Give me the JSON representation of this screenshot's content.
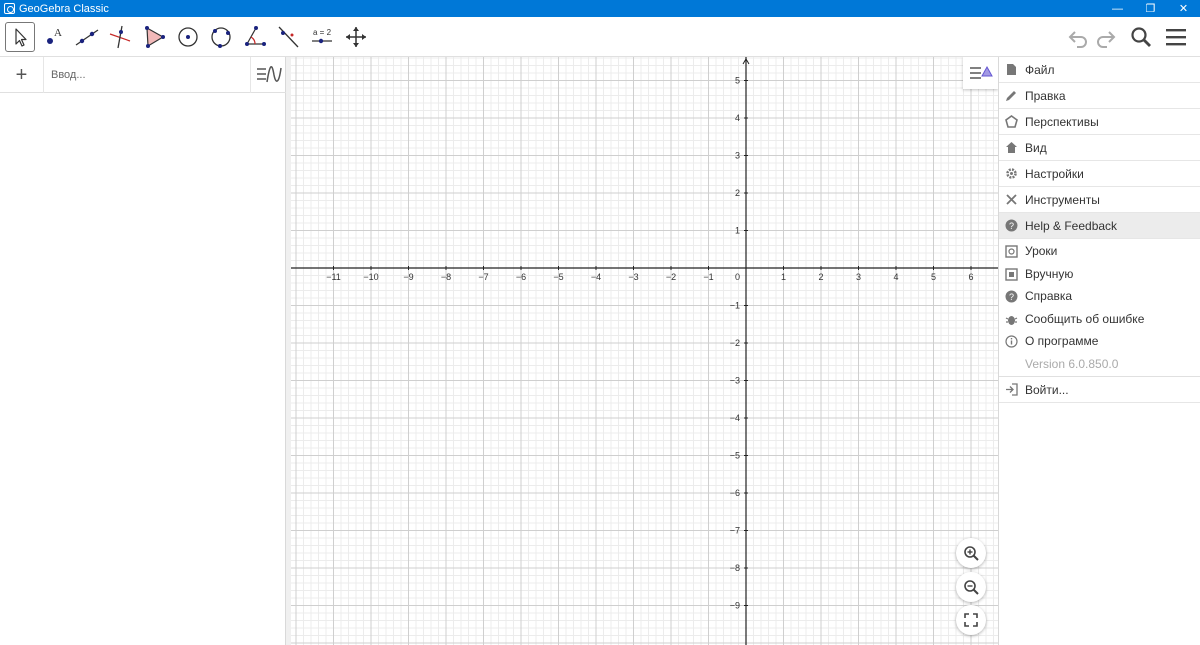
{
  "window": {
    "title": "GeoGebra Classic",
    "controls": [
      "—",
      "❐",
      "✕"
    ]
  },
  "toolbar": {
    "tools": [
      {
        "name": "move-tool",
        "icon": "arrow-pointer-icon"
      },
      {
        "name": "point-tool",
        "icon": "point-icon"
      },
      {
        "name": "line-tool",
        "icon": "line-icon"
      },
      {
        "name": "perpendicular-line-tool",
        "icon": "perpendicular-icon"
      },
      {
        "name": "polygon-tool",
        "icon": "polygon-icon"
      },
      {
        "name": "circle-center-point-tool",
        "icon": "circle-center-icon"
      },
      {
        "name": "circle-three-points-tool",
        "icon": "circle-three-points-icon"
      },
      {
        "name": "angle-tool",
        "icon": "angle-icon"
      },
      {
        "name": "reflect-tool",
        "icon": "reflect-icon"
      },
      {
        "name": "slider-tool",
        "icon": "slider-icon",
        "label": "a = 2"
      },
      {
        "name": "move-graphics-view-tool",
        "icon": "move-view-icon"
      }
    ]
  },
  "algebra": {
    "add_label": "+",
    "input_placeholder": "Ввод..."
  },
  "graphics": {
    "x_labels": [
      "−11",
      "−10",
      "−9",
      "−8",
      "−7",
      "−6",
      "−5",
      "−4",
      "−3",
      "−2",
      "−1",
      "1",
      "2",
      "3",
      "4",
      "5",
      "6"
    ],
    "y_labels": [
      "5",
      "4",
      "3",
      "2",
      "1",
      "−1",
      "−2",
      "−3",
      "−4",
      "−5",
      "−6",
      "−7",
      "−8",
      "−9"
    ],
    "origin_label": "0",
    "zoom_buttons": [
      "zoom-in-icon",
      "zoom-out-icon",
      "fullscreen-icon"
    ]
  },
  "menu": {
    "main_items": [
      {
        "label": "Файл",
        "icon": "file-icon"
      },
      {
        "label": "Правка",
        "icon": "pencil-icon"
      },
      {
        "label": "Перспективы",
        "icon": "perspectives-icon"
      },
      {
        "label": "Вид",
        "icon": "home-icon"
      },
      {
        "label": "Настройки",
        "icon": "gear-icon"
      },
      {
        "label": "Инструменты",
        "icon": "tools-icon"
      },
      {
        "label": "Help & Feedback",
        "icon": "help-icon"
      }
    ],
    "sub_items": [
      {
        "label": "Уроки",
        "icon": "tutorials-icon"
      },
      {
        "label": "Вручную",
        "icon": "manual-icon"
      },
      {
        "label": "Справка",
        "icon": "question-icon"
      },
      {
        "label": "Сообщить об ошибке",
        "icon": "bug-icon"
      },
      {
        "label": "О программе",
        "icon": "info-icon"
      }
    ],
    "version": "Version 6.0.850.0",
    "sign_in": {
      "label": "Войти...",
      "icon": "sign-in-icon"
    }
  },
  "colors": {
    "titlebar": "#0078d7",
    "accent": "#6557d2",
    "highlight": "#ececec"
  }
}
